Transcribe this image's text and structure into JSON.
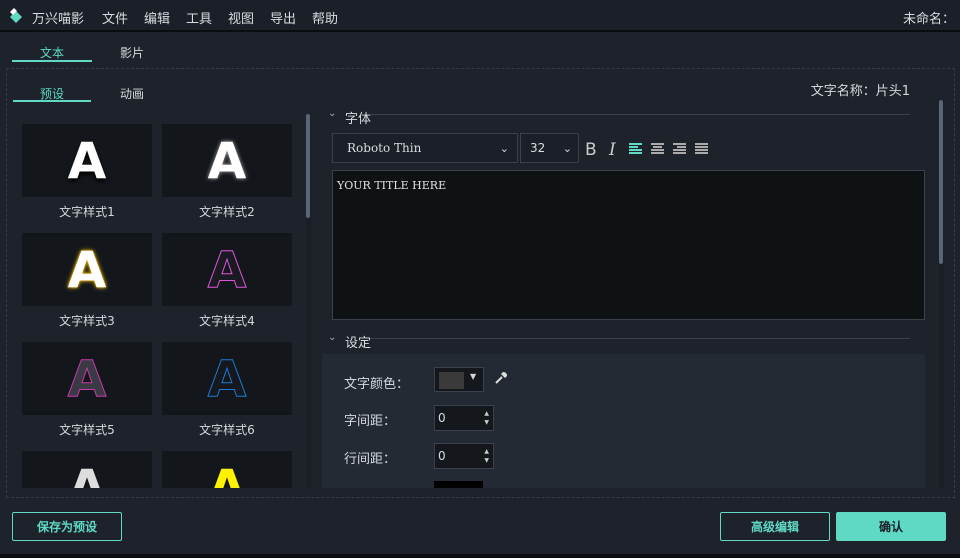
{
  "app": {
    "name": "万兴喵影",
    "doc_title": "未命名：",
    "menu": [
      "文件",
      "编辑",
      "工具",
      "视图",
      "导出",
      "帮助"
    ]
  },
  "tabs": {
    "main": [
      "文本",
      "影片"
    ],
    "sub": [
      "预设",
      "动画"
    ]
  },
  "presets": [
    {
      "label": "文字样式1",
      "style": "white-bold"
    },
    {
      "label": "文字样式2",
      "style": "white-glow"
    },
    {
      "label": "文字样式3",
      "style": "yellow-glow"
    },
    {
      "label": "文字样式4",
      "style": "pink-outline"
    },
    {
      "label": "文字样式5",
      "style": "magenta-outline"
    },
    {
      "label": "文字样式6",
      "style": "blue-outline"
    },
    {
      "label": "",
      "style": "white-gradient"
    },
    {
      "label": "",
      "style": "yellow"
    }
  ],
  "right": {
    "text_name": "文字名称：片头1",
    "font_section": "字体",
    "font": "Roboto Thin",
    "size": "32",
    "bold": "B",
    "italic": "I",
    "text": "YOUR TITLE HERE",
    "settings_section": "设定",
    "color_label": "文字颜色：",
    "color_value": "#3a3a3a",
    "char_spacing_label": "字间距：",
    "char_spacing": "0",
    "line_spacing_label": "行间距：",
    "line_spacing": "0"
  },
  "buttons": {
    "save_preset": "保存为预设",
    "advanced": "高级编辑",
    "ok": "确认"
  },
  "colors": {
    "accent": "#5fd8c4"
  }
}
